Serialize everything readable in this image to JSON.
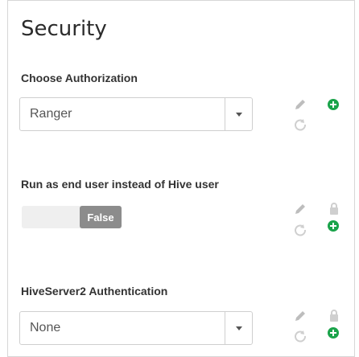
{
  "section": {
    "title": "Security",
    "items": [
      {
        "label": "Choose Authorization",
        "control": "select",
        "value": "Ranger"
      },
      {
        "label": "Run as end user instead of Hive user",
        "control": "toggle",
        "value": "False"
      },
      {
        "label": "HiveServer2 Authentication",
        "control": "select",
        "value": "None"
      }
    ]
  },
  "icons": {
    "edit": "pencil-icon",
    "undo": "undo-icon",
    "lock": "lock-icon",
    "add": "plus-circle-icon"
  },
  "colors": {
    "accent_add": "#1aa34a",
    "icon_gray": "#b9b9b9",
    "toggle_knob": "#8c8c8c"
  }
}
